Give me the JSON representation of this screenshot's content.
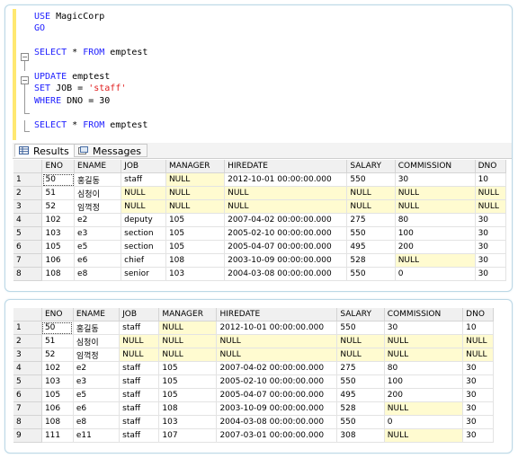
{
  "editor": {
    "lines": [
      {
        "parts": [
          {
            "k": "kw",
            "t": "USE "
          },
          {
            "k": "",
            "t": "MagicCorp"
          }
        ]
      },
      {
        "parts": [
          {
            "k": "kw",
            "t": "GO"
          }
        ]
      },
      {
        "parts": []
      },
      {
        "parts": [
          {
            "k": "kw",
            "t": "SELECT"
          },
          {
            "k": "",
            "t": " * "
          },
          {
            "k": "kw",
            "t": "FROM"
          },
          {
            "k": "",
            "t": " emptest"
          }
        ]
      },
      {
        "parts": []
      },
      {
        "parts": [
          {
            "k": "kw",
            "t": "UPDATE"
          },
          {
            "k": "",
            "t": " emptest"
          }
        ]
      },
      {
        "parts": [
          {
            "k": "kw",
            "t": "SET"
          },
          {
            "k": "",
            "t": " JOB = "
          },
          {
            "k": "str",
            "t": "'staff'"
          }
        ]
      },
      {
        "parts": [
          {
            "k": "kw",
            "t": "WHERE"
          },
          {
            "k": "",
            "t": " DNO = 30"
          }
        ]
      },
      {
        "parts": []
      },
      {
        "parts": [
          {
            "k": "kw",
            "t": "SELECT"
          },
          {
            "k": "",
            "t": " * "
          },
          {
            "k": "kw",
            "t": "FROM"
          },
          {
            "k": "",
            "t": " emptest"
          }
        ]
      }
    ]
  },
  "tabs": {
    "results": "Results",
    "messages": "Messages"
  },
  "columns": [
    "",
    "ENO",
    "ENAME",
    "JOB",
    "MANAGER",
    "HIREDATE",
    "SALARY",
    "COMMISSION",
    "DNO"
  ],
  "grid1": [
    [
      "1",
      "50",
      "홍길동",
      "staff",
      "NULL",
      "2012-10-01 00:00:00.000",
      "550",
      "30",
      "10"
    ],
    [
      "2",
      "51",
      "심청이",
      "NULL",
      "NULL",
      "NULL",
      "NULL",
      "NULL",
      "NULL"
    ],
    [
      "3",
      "52",
      "임꺽정",
      "NULL",
      "NULL",
      "NULL",
      "NULL",
      "NULL",
      "NULL"
    ],
    [
      "4",
      "102",
      "e2",
      "deputy",
      "105",
      "2007-04-02 00:00:00.000",
      "275",
      "80",
      "30"
    ],
    [
      "5",
      "103",
      "e3",
      "section",
      "105",
      "2005-02-10 00:00:00.000",
      "550",
      "100",
      "30"
    ],
    [
      "6",
      "105",
      "e5",
      "section",
      "105",
      "2005-04-07 00:00:00.000",
      "495",
      "200",
      "30"
    ],
    [
      "7",
      "106",
      "e6",
      "chief",
      "108",
      "2003-10-09 00:00:00.000",
      "528",
      "NULL",
      "30"
    ],
    [
      "8",
      "108",
      "e8",
      "senior",
      "103",
      "2004-03-08 00:00:00.000",
      "550",
      "0",
      "30"
    ]
  ],
  "grid2": [
    [
      "1",
      "50",
      "홍길동",
      "staff",
      "NULL",
      "2012-10-01 00:00:00.000",
      "550",
      "30",
      "10"
    ],
    [
      "2",
      "51",
      "심청이",
      "NULL",
      "NULL",
      "NULL",
      "NULL",
      "NULL",
      "NULL"
    ],
    [
      "3",
      "52",
      "임꺽정",
      "NULL",
      "NULL",
      "NULL",
      "NULL",
      "NULL",
      "NULL"
    ],
    [
      "4",
      "102",
      "e2",
      "staff",
      "105",
      "2007-04-02 00:00:00.000",
      "275",
      "80",
      "30"
    ],
    [
      "5",
      "103",
      "e3",
      "staff",
      "105",
      "2005-02-10 00:00:00.000",
      "550",
      "100",
      "30"
    ],
    [
      "6",
      "105",
      "e5",
      "staff",
      "105",
      "2005-04-07 00:00:00.000",
      "495",
      "200",
      "30"
    ],
    [
      "7",
      "106",
      "e6",
      "staff",
      "108",
      "2003-10-09 00:00:00.000",
      "528",
      "NULL",
      "30"
    ],
    [
      "8",
      "108",
      "e8",
      "staff",
      "103",
      "2004-03-08 00:00:00.000",
      "550",
      "0",
      "30"
    ],
    [
      "9",
      "111",
      "e11",
      "staff",
      "107",
      "2007-03-01 00:00:00.000",
      "308",
      "NULL",
      "30"
    ]
  ],
  "colors": {
    "null_bg": "#fffbd0",
    "keyword": "#2020ff",
    "string": "#e02020",
    "panel_border": "#bcd8e6"
  },
  "icons": {
    "results": "grid-icon",
    "messages": "messages-icon"
  }
}
